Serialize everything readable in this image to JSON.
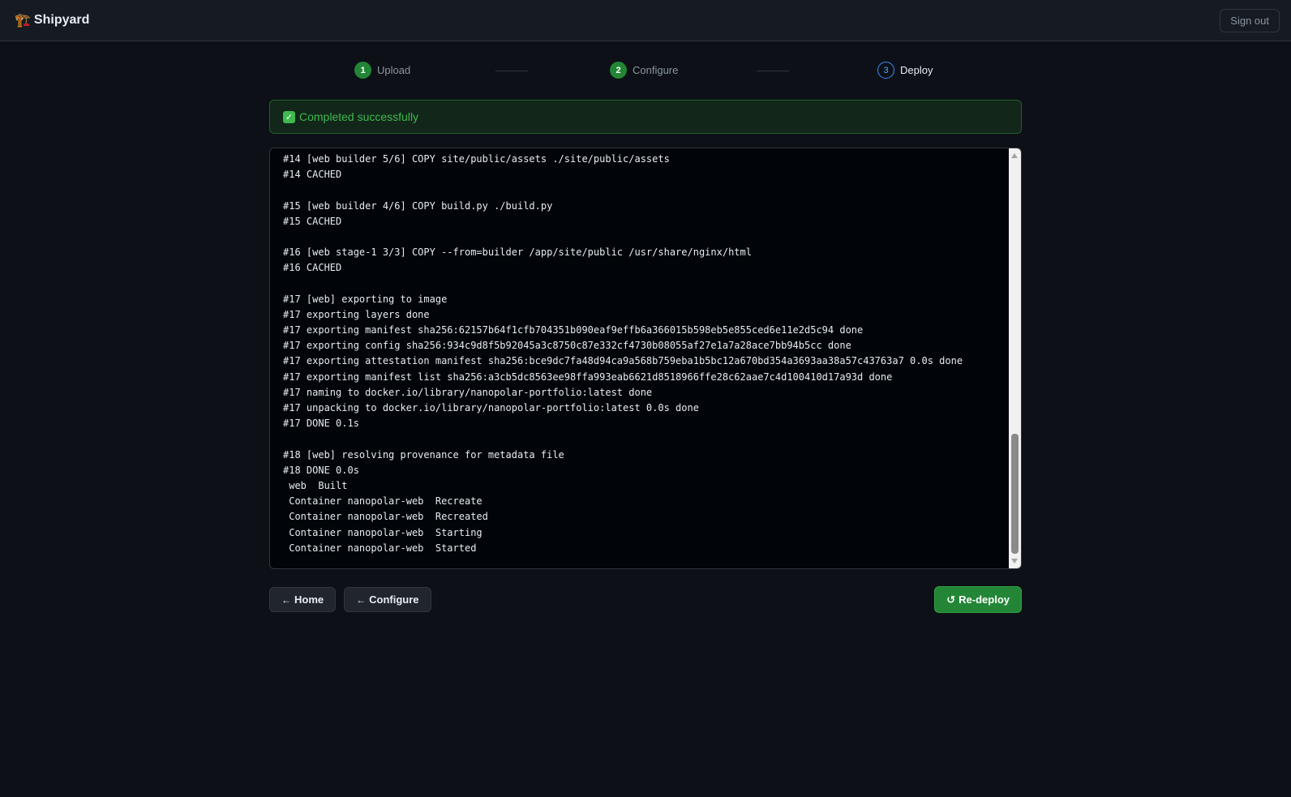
{
  "header": {
    "logo_icon": "crane-icon",
    "logo_glyph": "🏗️",
    "title": "Shipyard",
    "signout_label": "Sign out"
  },
  "stepper": {
    "steps": [
      {
        "number": "1",
        "label": "Upload",
        "state": "done"
      },
      {
        "number": "2",
        "label": "Configure",
        "state": "done"
      },
      {
        "number": "3",
        "label": "Deploy",
        "state": "active"
      }
    ]
  },
  "status": {
    "icon": "check-icon",
    "message": "Completed successfully",
    "color": "#3fb950"
  },
  "log": {
    "lines": [
      "#14 [web builder 5/6] COPY site/public/assets ./site/public/assets",
      "#14 CACHED",
      "",
      "#15 [web builder 4/6] COPY build.py ./build.py",
      "#15 CACHED",
      "",
      "#16 [web stage-1 3/3] COPY --from=builder /app/site/public /usr/share/nginx/html",
      "#16 CACHED",
      "",
      "#17 [web] exporting to image",
      "#17 exporting layers done",
      "#17 exporting manifest sha256:62157b64f1cfb704351b090eaf9effb6a366015b598eb5e855ced6e11e2d5c94 done",
      "#17 exporting config sha256:934c9d8f5b92045a3c8750c87e332cf4730b08055af27e1a7a28ace7bb94b5cc done",
      "#17 exporting attestation manifest sha256:bce9dc7fa48d94ca9a568b759eba1b5bc12a670bd354a3693aa38a57c43763a7 0.0s done",
      "#17 exporting manifest list sha256:a3cb5dc8563ee98ffa993eab6621d8518966ffe28c62aae7c4d100410d17a93d done",
      "#17 naming to docker.io/library/nanopolar-portfolio:latest done",
      "#17 unpacking to docker.io/library/nanopolar-portfolio:latest 0.0s done",
      "#17 DONE 0.1s",
      "",
      "#18 [web] resolving provenance for metadata file",
      "#18 DONE 0.0s",
      " web  Built",
      " Container nanopolar-web  Recreate",
      " Container nanopolar-web  Recreated",
      " Container nanopolar-web  Starting",
      " Container nanopolar-web  Started"
    ]
  },
  "actions": {
    "home_label": "Home",
    "configure_label": "Configure",
    "redeploy_label": "Re-deploy",
    "back_arrow": "←",
    "redeploy_glyph": "↺"
  },
  "colors": {
    "background": "#0d1117",
    "accent_green": "#238636",
    "active_blue": "#58a6ff"
  }
}
